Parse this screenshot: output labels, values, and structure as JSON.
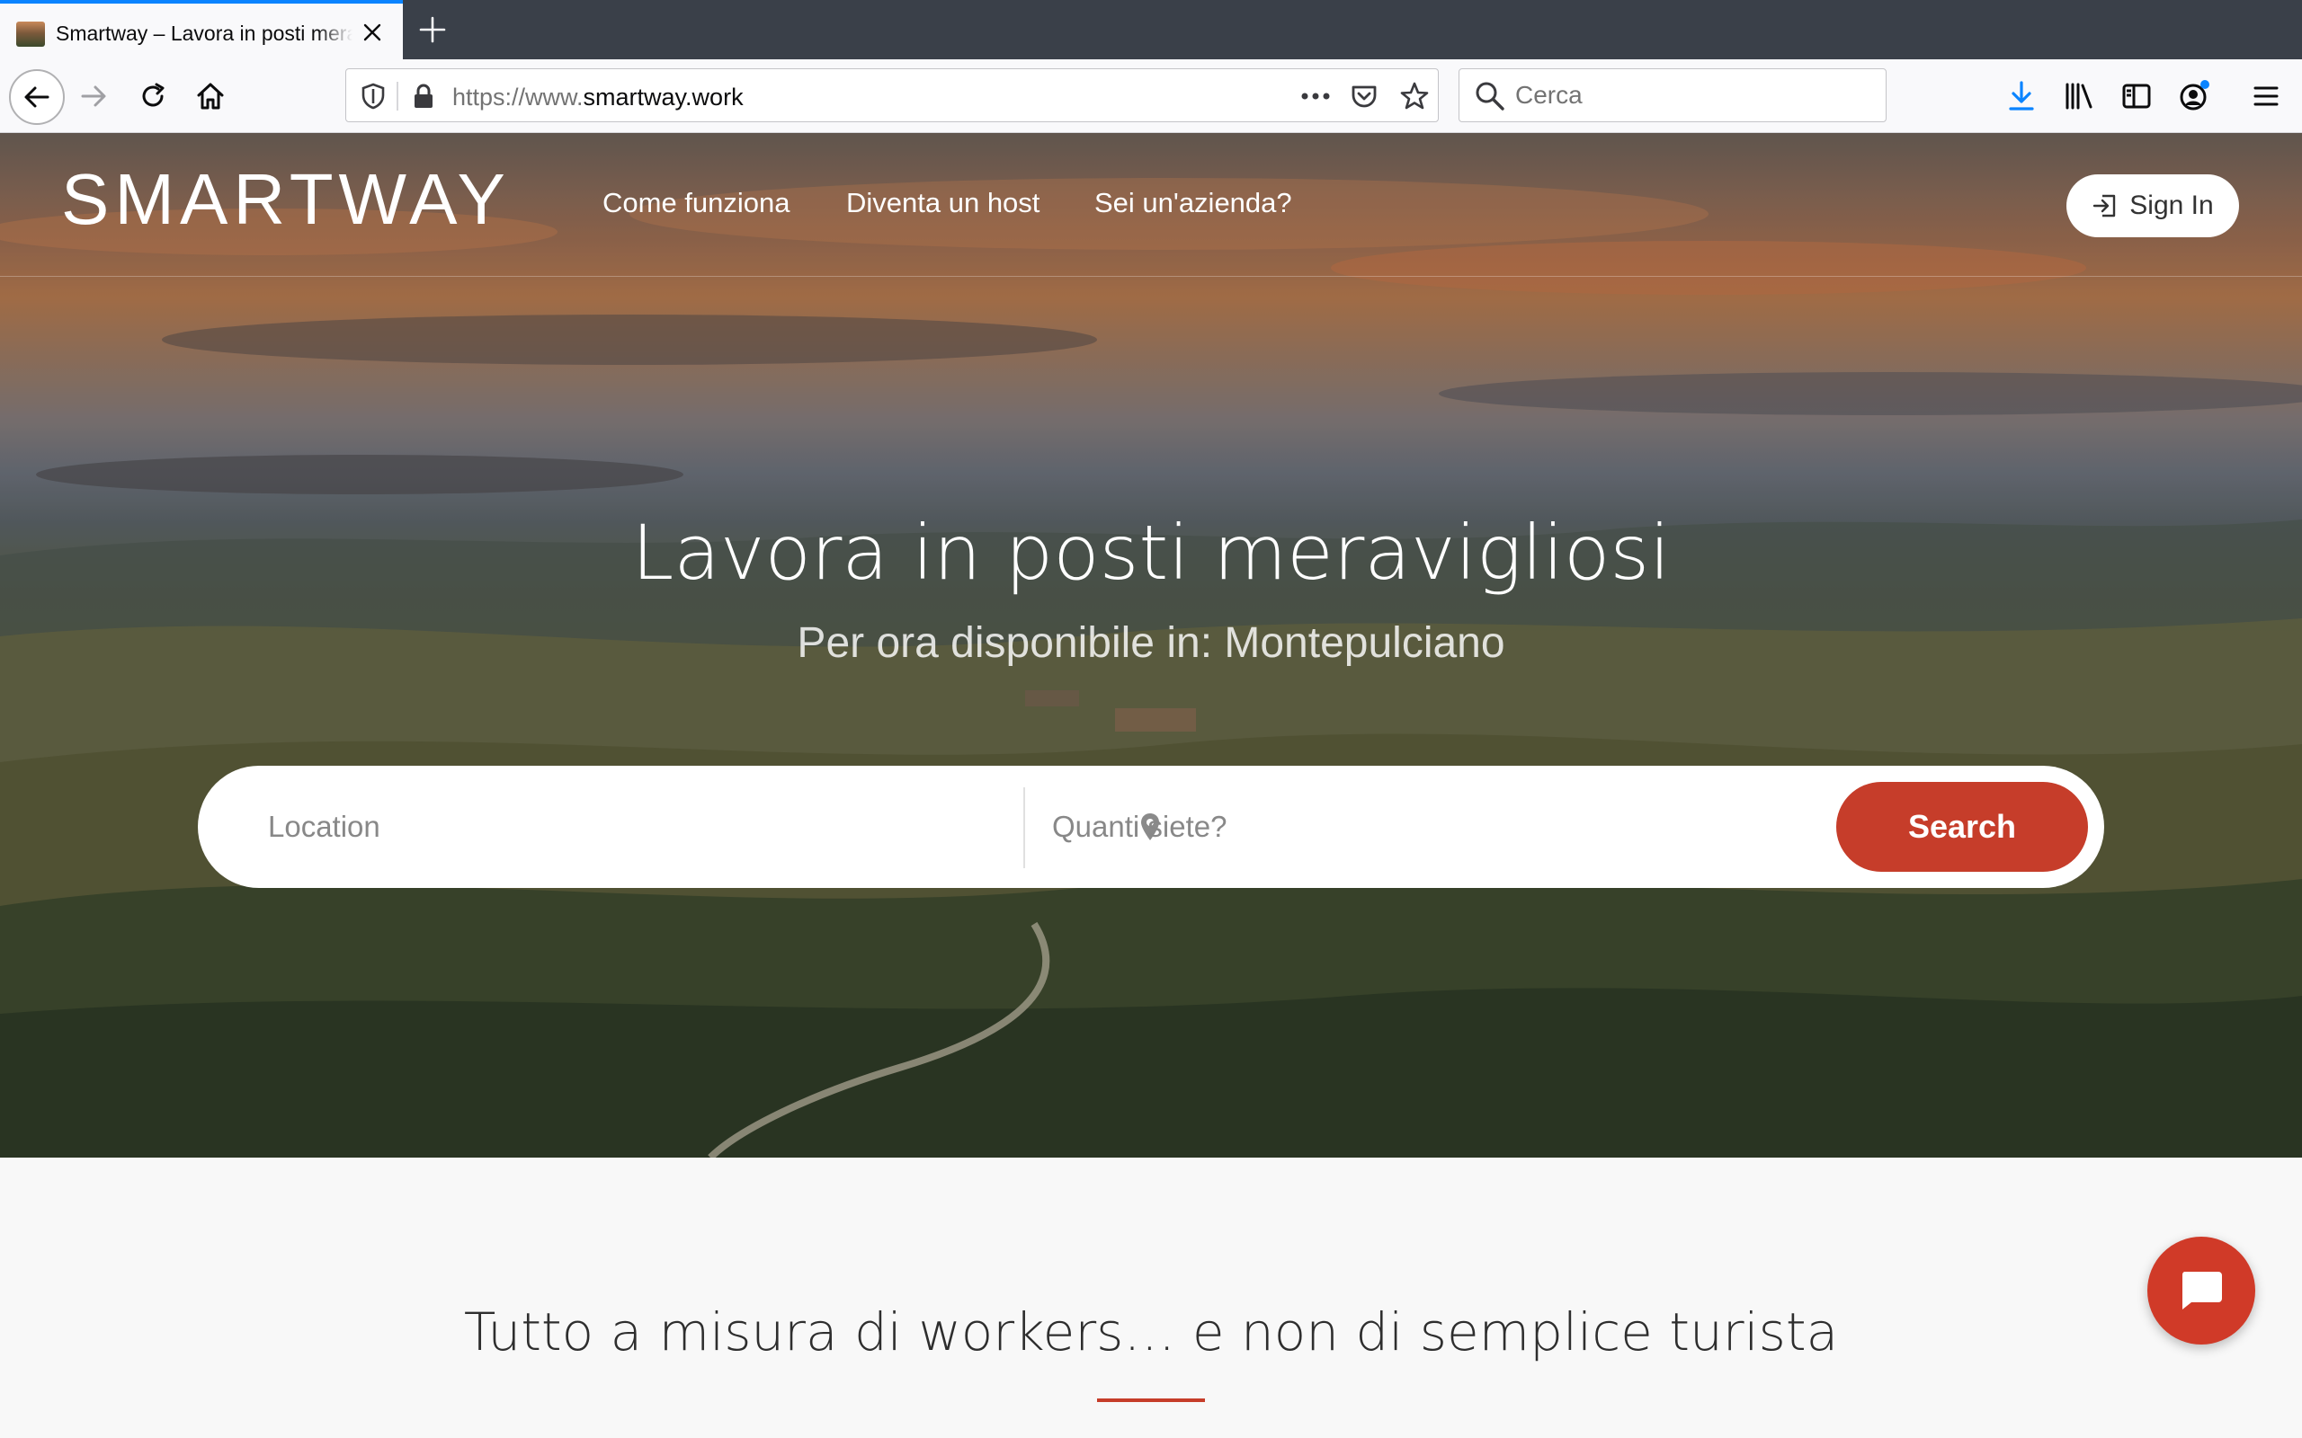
{
  "browser": {
    "tab_title": "Smartway – Lavora in posti meravigliosi",
    "url_prefix": "https://www.",
    "url_domain": "smartway.work",
    "search_placeholder": "Cerca",
    "accent": "#0a84ff",
    "icons": [
      "back-arrow-icon",
      "forward-arrow-icon",
      "reload-icon",
      "home-icon",
      "tracking-shield-icon",
      "lock-icon",
      "page-actions-icon",
      "pocket-icon",
      "bookmark-star-icon",
      "search-icon",
      "download-icon",
      "library-icon",
      "sidebar-icon",
      "account-icon",
      "menu-icon",
      "new-tab-icon",
      "close-icon"
    ]
  },
  "site": {
    "logo": "SMARTWAY",
    "nav": [
      "Come funziona",
      "Diventa un host",
      "Sei un'azienda?"
    ],
    "signin_label": "Sign In",
    "brand_color": "#c63d2a"
  },
  "hero": {
    "title": "Lavora in posti meravigliosi",
    "subtitle": "Per ora disponibile in: Montepulciano",
    "location_placeholder": "Location",
    "people_placeholder": "Quanti siete?",
    "search_label": "Search"
  },
  "section": {
    "title": "Tutto a misura di workers… e non di semplice turista"
  }
}
